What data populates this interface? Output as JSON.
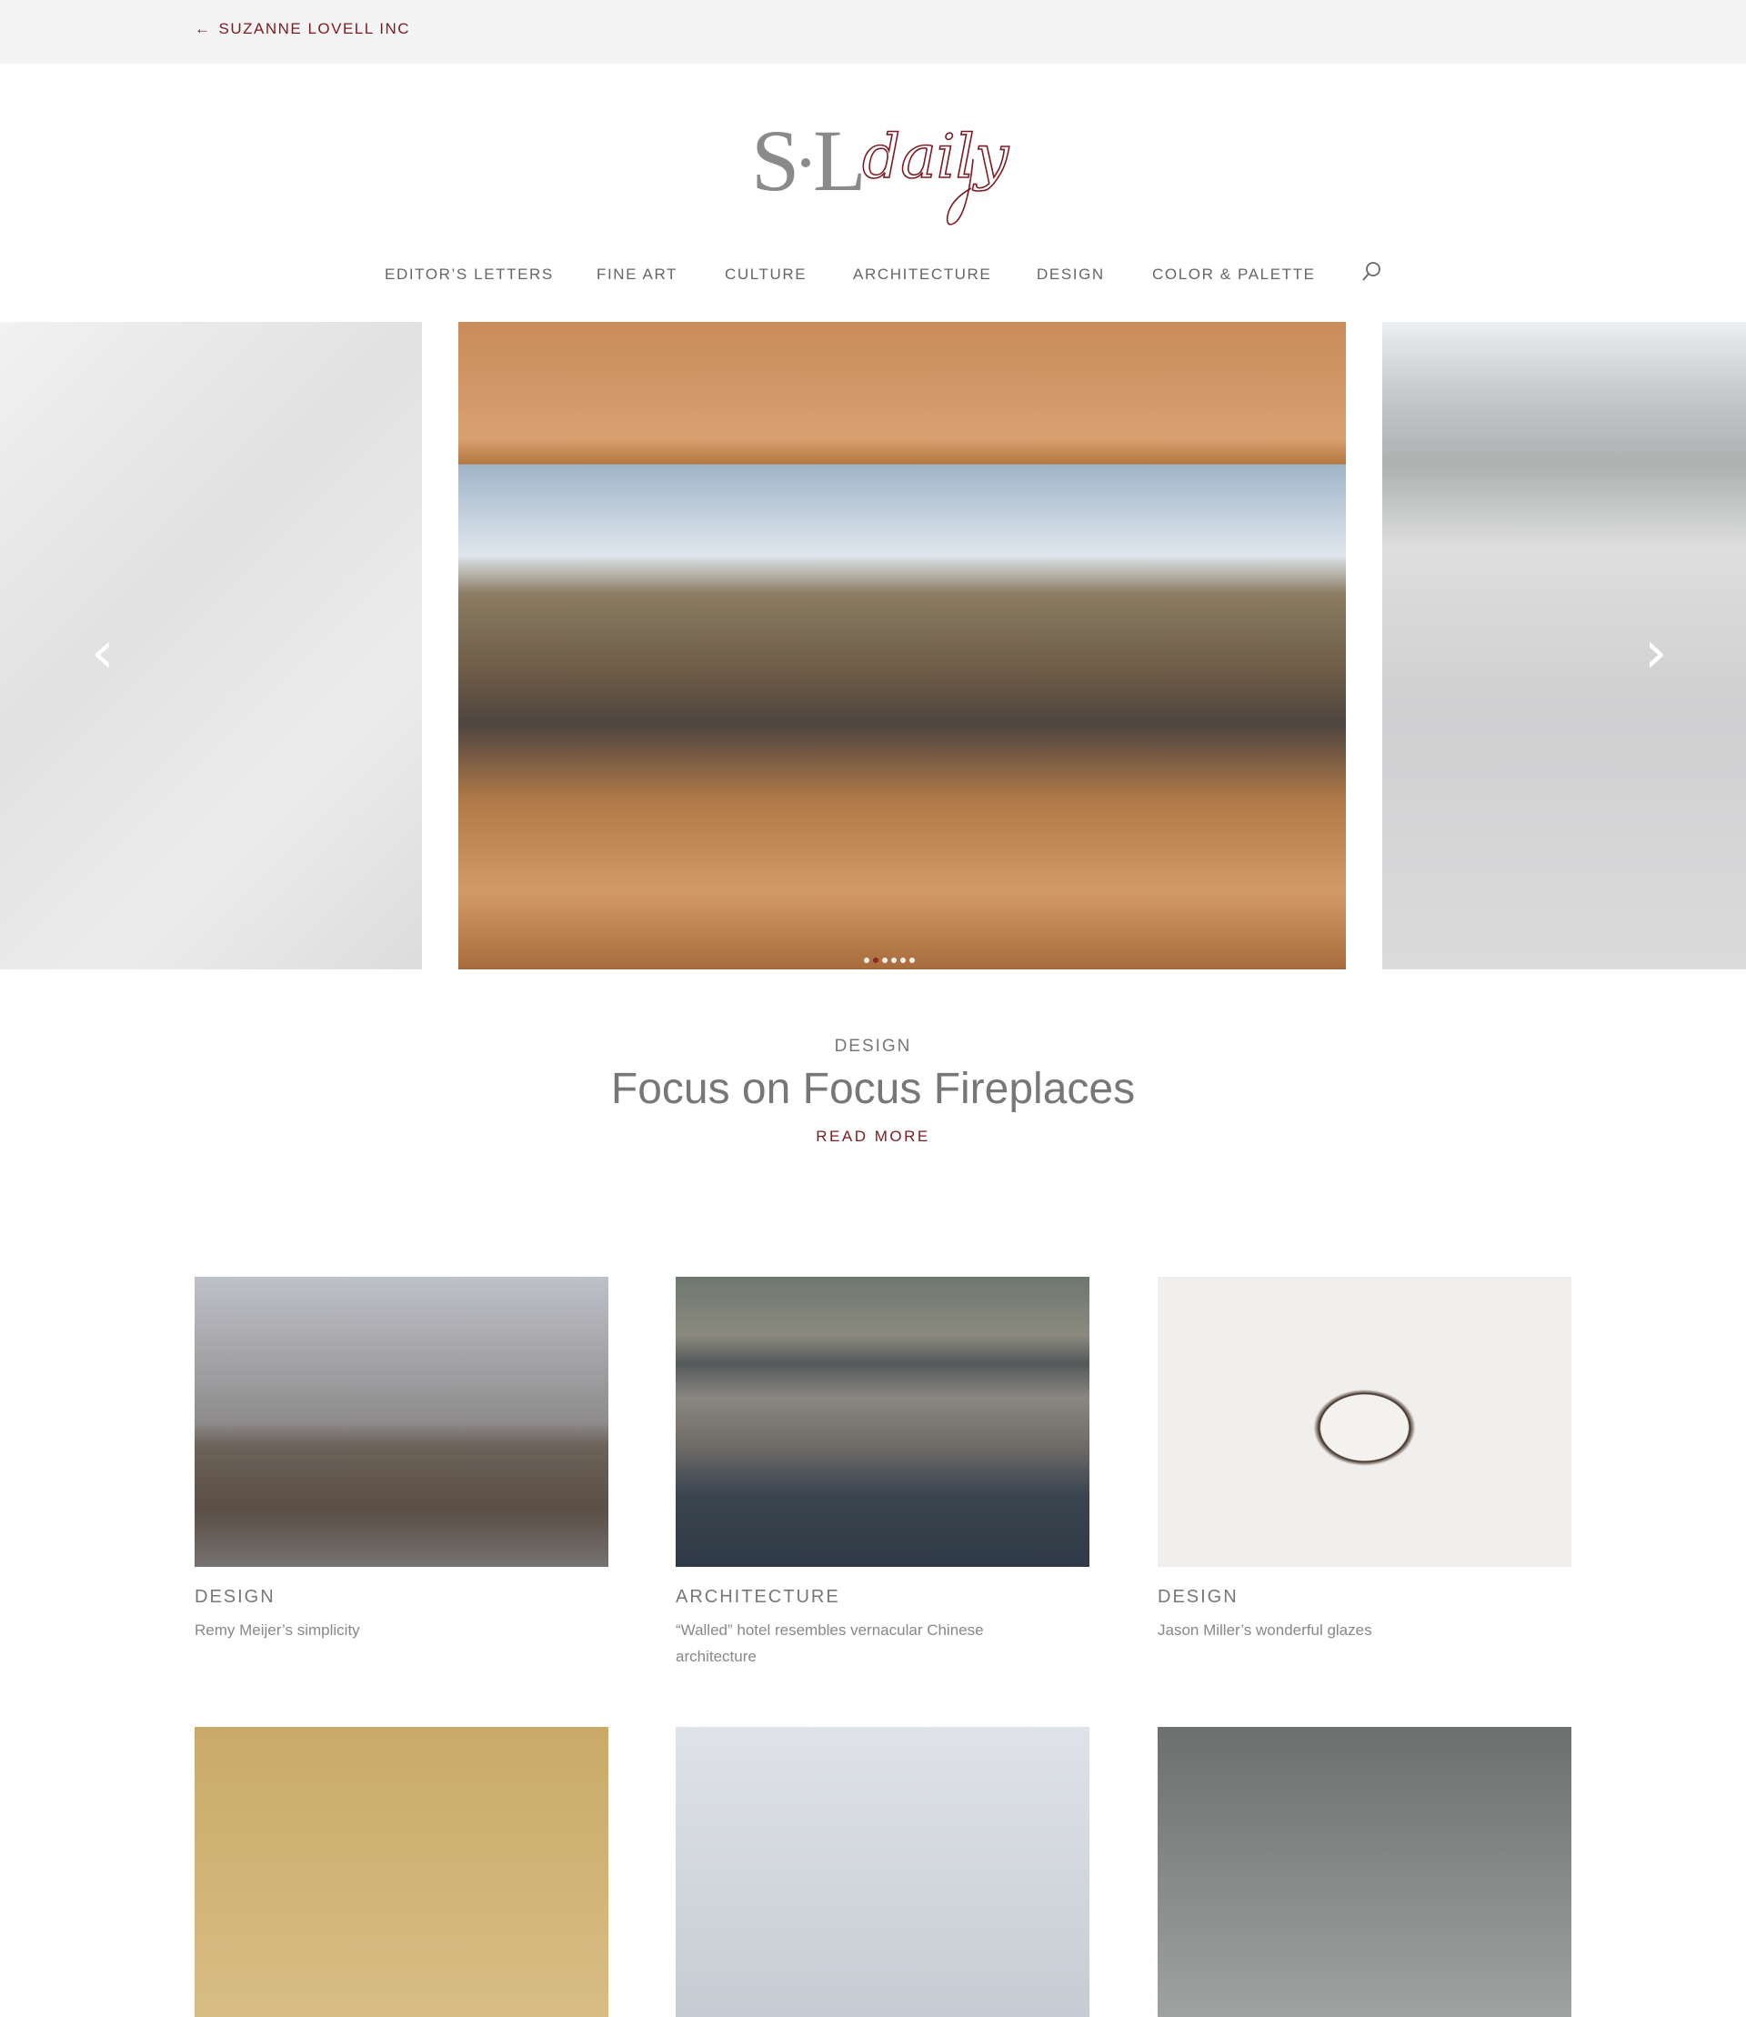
{
  "topbar": {
    "back_label": "SUZANNE LOVELL INC"
  },
  "logo": {
    "text_main": "S·L",
    "text_script": "daily"
  },
  "nav": {
    "items": [
      "EDITOR’S LETTERS",
      "FINE ART",
      "CULTURE",
      "ARCHITECTURE",
      "DESIGN",
      "COLOR & PALETTE"
    ]
  },
  "carousel": {
    "slide_count": 6,
    "active_index": 1
  },
  "featured": {
    "category": "DESIGN",
    "title": "Focus on Focus Fireplaces",
    "read_more": "READ MORE"
  },
  "cards": [
    {
      "category": "DESIGN",
      "title": "Remy Meijer’s simplicity"
    },
    {
      "category": "ARCHITECTURE",
      "title": "“Walled” hotel resembles vernacular Chinese architecture"
    },
    {
      "category": "DESIGN",
      "title": "Jason Miller’s wonderful glazes"
    }
  ],
  "colors": {
    "accent": "#7a1a22",
    "topbar": "#f4f4f4",
    "text": "#666666"
  }
}
